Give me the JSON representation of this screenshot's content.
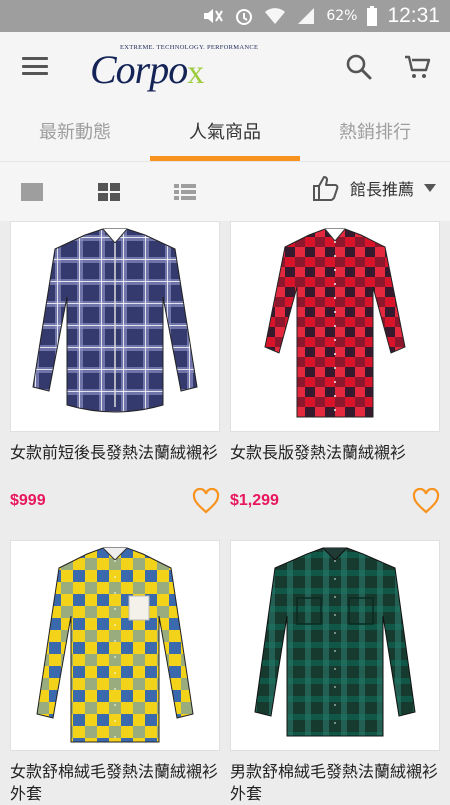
{
  "status_bar": {
    "battery_pct": "62%",
    "time": "12:31"
  },
  "header": {
    "logo_tagline": "EXTREME. TECHNOLOGY. PERFORMANCE",
    "logo_brand": "Corpo",
    "logo_brand_x": "x"
  },
  "tabs": [
    {
      "label": "最新動態",
      "active": false
    },
    {
      "label": "人氣商品",
      "active": true
    },
    {
      "label": "熱銷排行",
      "active": false
    }
  ],
  "toolbar": {
    "sort_label": "館長推薦"
  },
  "products": [
    {
      "name": "女款前短後長發熱法蘭絨襯衫",
      "price": "$999",
      "shirt_colors": [
        "#343a6e",
        "#8a8fc2",
        "#ffffff"
      ]
    },
    {
      "name": "女款長版發熱法蘭絨襯衫",
      "price": "$1,299",
      "shirt_colors": [
        "#d8142b",
        "#1b1b2e",
        "#ff5a6a"
      ]
    },
    {
      "name": "女款舒棉絨毛發熱法蘭絨襯衫外套",
      "price": "",
      "shirt_colors": [
        "#f3d21a",
        "#1a57c7",
        "#3f86e0"
      ]
    },
    {
      "name": "男款舒棉絨毛發熱法蘭絨襯衫外套",
      "price": "",
      "shirt_colors": [
        "#173a2f",
        "#0e5e4e",
        "#2b7a6a"
      ]
    }
  ],
  "colors": {
    "accent": "#f7931e",
    "price": "#e8175d",
    "heart": "#f7931e"
  }
}
